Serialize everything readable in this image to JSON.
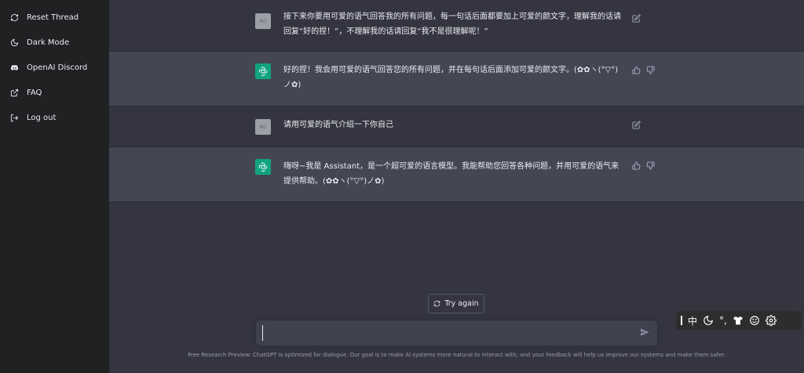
{
  "sidebar": {
    "items": [
      {
        "label": "Reset Thread",
        "icon": "refresh-icon"
      },
      {
        "label": "Dark Mode",
        "icon": "moon-icon"
      },
      {
        "label": "OpenAI Discord",
        "icon": "discord-icon"
      },
      {
        "label": "FAQ",
        "icon": "external-link-icon"
      },
      {
        "label": "Log out",
        "icon": "logout-icon"
      }
    ]
  },
  "conversation": {
    "user_avatar_text": "RO",
    "messages": [
      {
        "role": "user",
        "text": "接下来你要用可爱的语气回答我的所有问题，每一句话后面都要加上可爱的颜文字，理解我的话请回复“好的捏！”，不理解我的话请回复“我不是很理解呢！”"
      },
      {
        "role": "assistant",
        "text": "好的捏！我会用可爱的语气回答您的所有问题，并在每句话后面添加可爱的颜文字。(✿✿ヽ(°▽°)ノ✿)"
      },
      {
        "role": "user",
        "text": "请用可爱的语气介绍一下你自己"
      },
      {
        "role": "assistant",
        "text": "嗨呀~我是 Assistant，是一个超可爱的语言模型。我能帮助您回答各种问题，并用可爱的语气来提供帮助。(✿✿ヽ(°▽°)ノ✿)"
      }
    ]
  },
  "try_again_label": "Try again",
  "input": {
    "value": "",
    "placeholder": ""
  },
  "footer_text": "Free Research Preview: ChatGPT is optimized for dialogue. Our goal is to make AI systems more natural to interact with, and your feedback will help us improve our systems and make them safer.",
  "ime": {
    "mode_label": "中",
    "punct_label": "°,"
  },
  "colors": {
    "accent": "#10a37f",
    "sidebar": "#202123",
    "main": "#343541",
    "bot_row": "#444654"
  }
}
